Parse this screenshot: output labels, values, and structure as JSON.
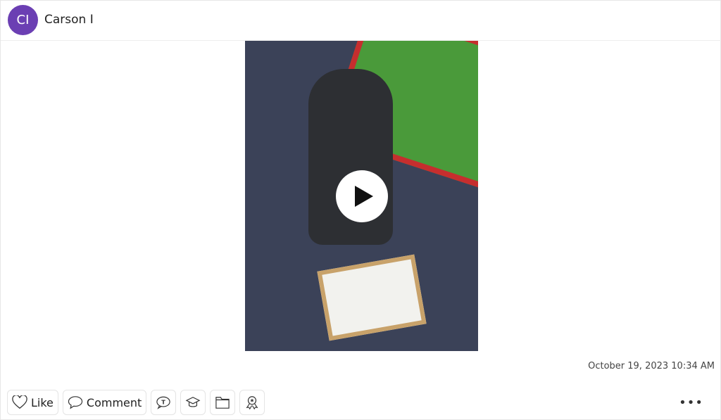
{
  "header": {
    "avatar_initials": "CI",
    "name": "Carson I",
    "avatar_color": "#6b3fb3"
  },
  "post": {
    "media_type": "video",
    "play_icon": "play-icon",
    "timestamp": "October 19, 2023 10:34 AM"
  },
  "actions": {
    "like_label": "Like",
    "comment_label": "Comment",
    "icons": [
      "heart-icon",
      "speech-bubble-icon",
      "translate-icon",
      "graduation-cap-icon",
      "folder-icon",
      "award-ribbon-icon",
      "more-icon"
    ],
    "more_label": "•••"
  }
}
